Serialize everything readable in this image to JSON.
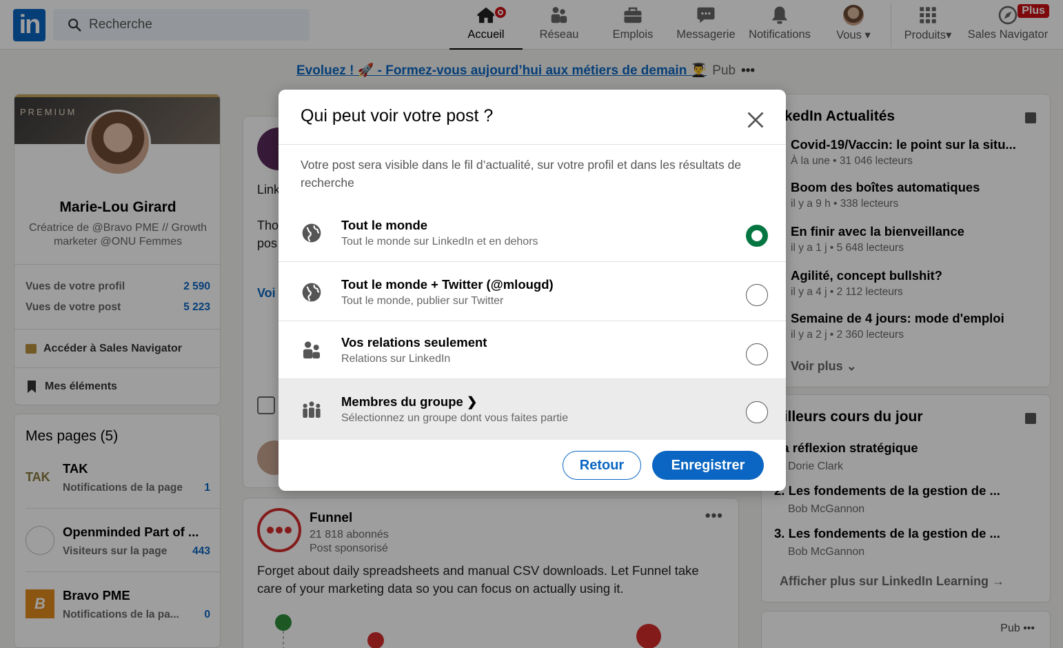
{
  "nav": {
    "logo_text": "in",
    "search_placeholder": "Recherche",
    "items": [
      {
        "label": "Accueil",
        "icon": "home-icon",
        "active": true
      },
      {
        "label": "Réseau",
        "icon": "people-icon"
      },
      {
        "label": "Emplois",
        "icon": "briefcase-icon"
      },
      {
        "label": "Messagerie",
        "icon": "chat-icon"
      },
      {
        "label": "Notifications",
        "icon": "bell-icon"
      },
      {
        "label": "Vous",
        "icon": "avatar"
      },
      {
        "label": "Produits",
        "icon": "grid-icon"
      },
      {
        "label": "Sales Navigator",
        "icon": "compass-icon"
      }
    ],
    "plus_badge": "Plus",
    "accent_color": "#0a66c2"
  },
  "ad_banner": {
    "text": "Evoluez ! 🚀 - Formez-vous aujourd’hui aux métiers de demain 👨‍🎓",
    "pub": "Pub"
  },
  "profile": {
    "premium": "PREMIUM",
    "name": "Marie-Lou Girard",
    "headline": "Créatrice de @Bravo PME // Growth marketer @ONU Femmes",
    "stats": [
      {
        "label": "Vues de votre profil",
        "value": "2 590"
      },
      {
        "label": "Vues de votre post",
        "value": "5 223"
      }
    ],
    "sales_navigator_link": "Accéder à Sales Navigator",
    "items_link": "Mes éléments"
  },
  "pages": {
    "title": "Mes pages (5)",
    "items": [
      {
        "name": "TAK",
        "sub": "Notifications de la page",
        "count": "1"
      },
      {
        "name": "Openminded Part of ...",
        "sub": "Visiteurs sur la page",
        "count": "443"
      },
      {
        "name": "Bravo PME",
        "sub": "Notifications de la pa...",
        "count": "0"
      }
    ]
  },
  "post_bg": {
    "fragments": [
      "Link",
      "Tho",
      "pos",
      "Voi"
    ]
  },
  "funnel": {
    "name": "Funnel",
    "followers": "21 818 abonnés",
    "sponsored": "Post sponsorisé",
    "text": "Forget about daily spreadsheets and manual CSV downloads. Let Funnel take care of your marketing data so you can focus on actually using it."
  },
  "news": {
    "title": "nkedIn Actualités",
    "items": [
      {
        "title": "Covid-19/Vaccin: le point sur la situ...",
        "meta": "À la une • 31 046 lecteurs"
      },
      {
        "title": "Boom des boîtes automatiques",
        "meta": "il y a 9 h • 338 lecteurs"
      },
      {
        "title": "En finir avec la bienveillance",
        "meta": "il y a 1 j • 5 648 lecteurs"
      },
      {
        "title": "Agilité, concept bullshit?",
        "meta": "il y a 4 j • 2 112 lecteurs"
      },
      {
        "title": "Semaine de 4 jours: mode d'emploi",
        "meta": "il y a 2 j • 2 360 lecteurs"
      }
    ],
    "more": "Voir plus"
  },
  "courses": {
    "title": "eilleurs cours du jour",
    "items": [
      {
        "title": "La réflexion stratégique",
        "author": "Dorie Clark"
      },
      {
        "title": "2. Les fondements de la gestion de ...",
        "author": "Bob McGannon"
      },
      {
        "title": "3. Les fondements de la gestion de ...",
        "author": "Bob McGannon"
      }
    ],
    "more": "Afficher plus sur LinkedIn Learning →"
  },
  "right_ad": {
    "pub": "Pub"
  },
  "modal": {
    "title": "Qui peut voir votre post ?",
    "description": "Votre post sera visible dans le fil d’actualité, sur votre profil et dans les résultats de recherche",
    "options": [
      {
        "title": "Tout le monde",
        "sub": "Tout le monde sur LinkedIn et en dehors",
        "icon": "globe-icon",
        "selected": true
      },
      {
        "title": "Tout le monde + Twitter (@mlougd)",
        "sub": "Tout le monde, publier sur Twitter",
        "icon": "globe-icon",
        "selected": false
      },
      {
        "title": "Vos relations seulement",
        "sub": "Relations sur LinkedIn",
        "icon": "people-icon",
        "selected": false
      },
      {
        "title": "Membres du groupe ❯",
        "sub": "Sélectionnez un groupe dont vous faites partie",
        "icon": "group-icon",
        "selected": false
      }
    ],
    "back_label": "Retour",
    "save_label": "Enregistrer",
    "selected_color": "#057642"
  }
}
